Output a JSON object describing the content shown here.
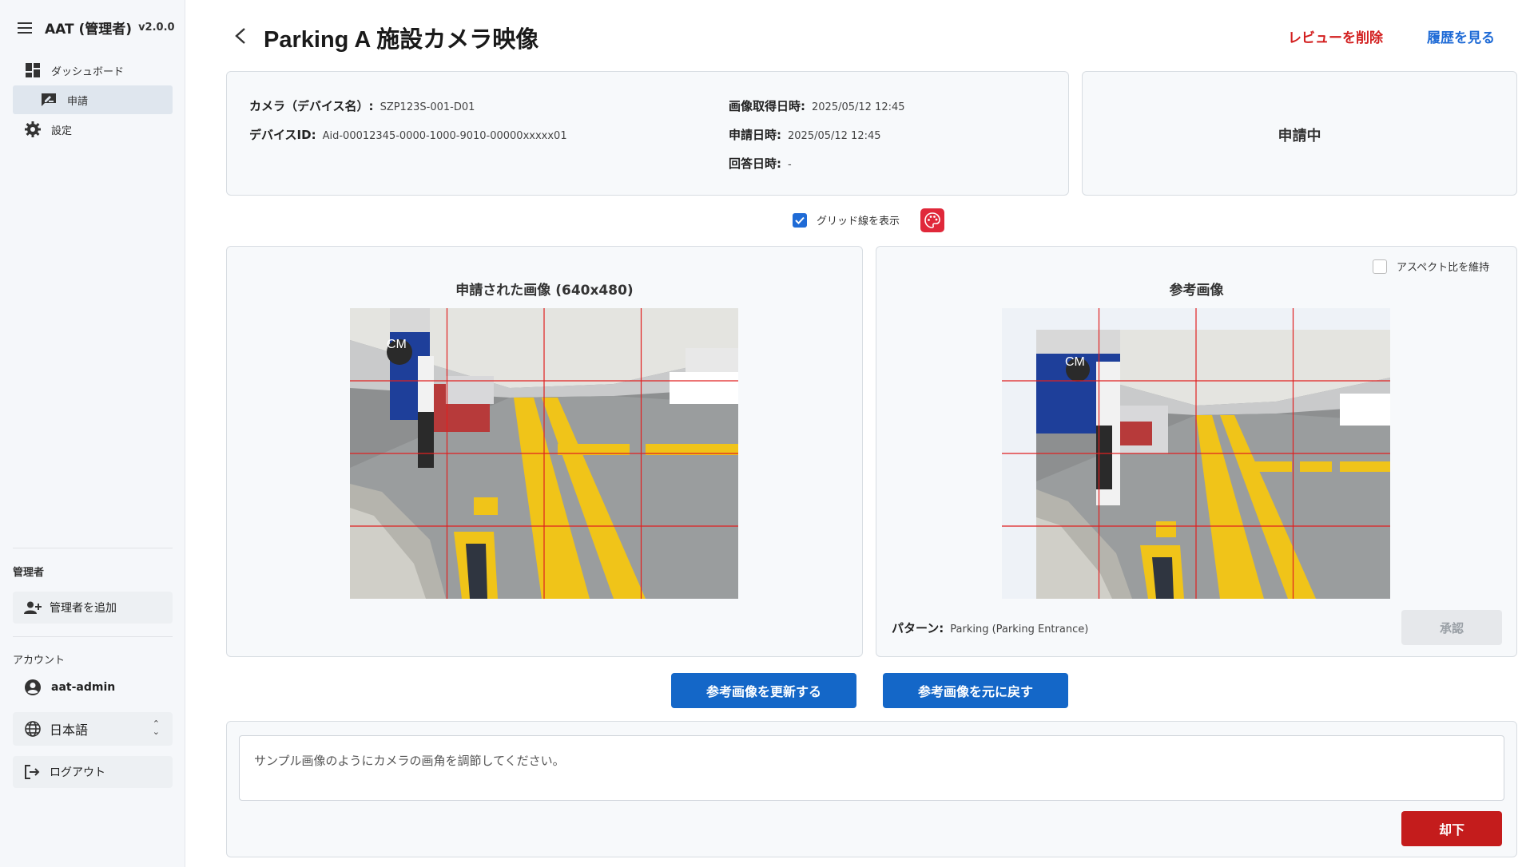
{
  "app": {
    "title": "AAT (管理者)",
    "version": "v2.0.0"
  },
  "sidebar": {
    "nav": [
      {
        "label": "ダッシュボード",
        "icon": "dashboard-icon"
      },
      {
        "label": "申請",
        "icon": "rate-review-icon",
        "active": true
      },
      {
        "label": "設定",
        "icon": "gear-icon"
      }
    ],
    "admin_section": "管理者",
    "add_admin": "管理者を追加",
    "account_section": "アカウント",
    "username": "aat-admin",
    "language": "日本語",
    "logout": "ログアウト"
  },
  "header": {
    "title": "Parking A 施設カメラ映像",
    "delete_review": "レビューを削除",
    "view_history": "履歴を見る"
  },
  "info": {
    "camera_label": "カメラ（デバイス名）:",
    "camera_value": "SZP123S-001-D01",
    "device_label": "デバイスID:",
    "device_value": "Aid-00012345-0000-1000-9010-00000xxxxx01",
    "capture_label": "画像取得日時:",
    "capture_value": "2025/05/12 12:45",
    "request_label": "申請日時:",
    "request_value": "2025/05/12 12:45",
    "answer_label": "回答日時:",
    "answer_value": "-"
  },
  "status": "申請中",
  "grid_toggle": {
    "label": "グリッド線を表示",
    "checked": true
  },
  "submitted": {
    "title": "申請された画像 (640x480)"
  },
  "reference": {
    "title": "参考画像",
    "aspect_label": "アスペクト比を維持",
    "aspect_checked": false,
    "pattern_label": "パターン:",
    "pattern_value": "Parking (Parking Entrance)",
    "approve": "承認"
  },
  "actions": {
    "update_reference": "参考画像を更新する",
    "restore_reference": "参考画像を元に戻す"
  },
  "comment": "サンプル画像のようにカメラの画角を調節してください。",
  "reject": "却下",
  "colors": {
    "accent_blue": "#1467c8",
    "danger_red": "#c41c1c",
    "grid_line": "#e02020"
  }
}
